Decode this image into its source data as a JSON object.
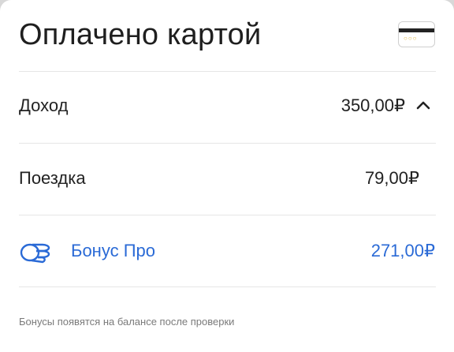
{
  "header": {
    "title": "Оплачено картой",
    "card_icon": "bank-card-icon"
  },
  "rows": [
    {
      "label": "Доход",
      "value": "350,00₽",
      "expanded": true,
      "icon": "chevron-up-icon"
    },
    {
      "label": "Поездка",
      "value": "79,00₽"
    }
  ],
  "bonus": {
    "label": "Бонус Про",
    "value": "271,00₽",
    "icon": "coins-icon",
    "color": "#2a6ad6"
  },
  "footnote": "Бонусы появятся на балансе после проверки"
}
